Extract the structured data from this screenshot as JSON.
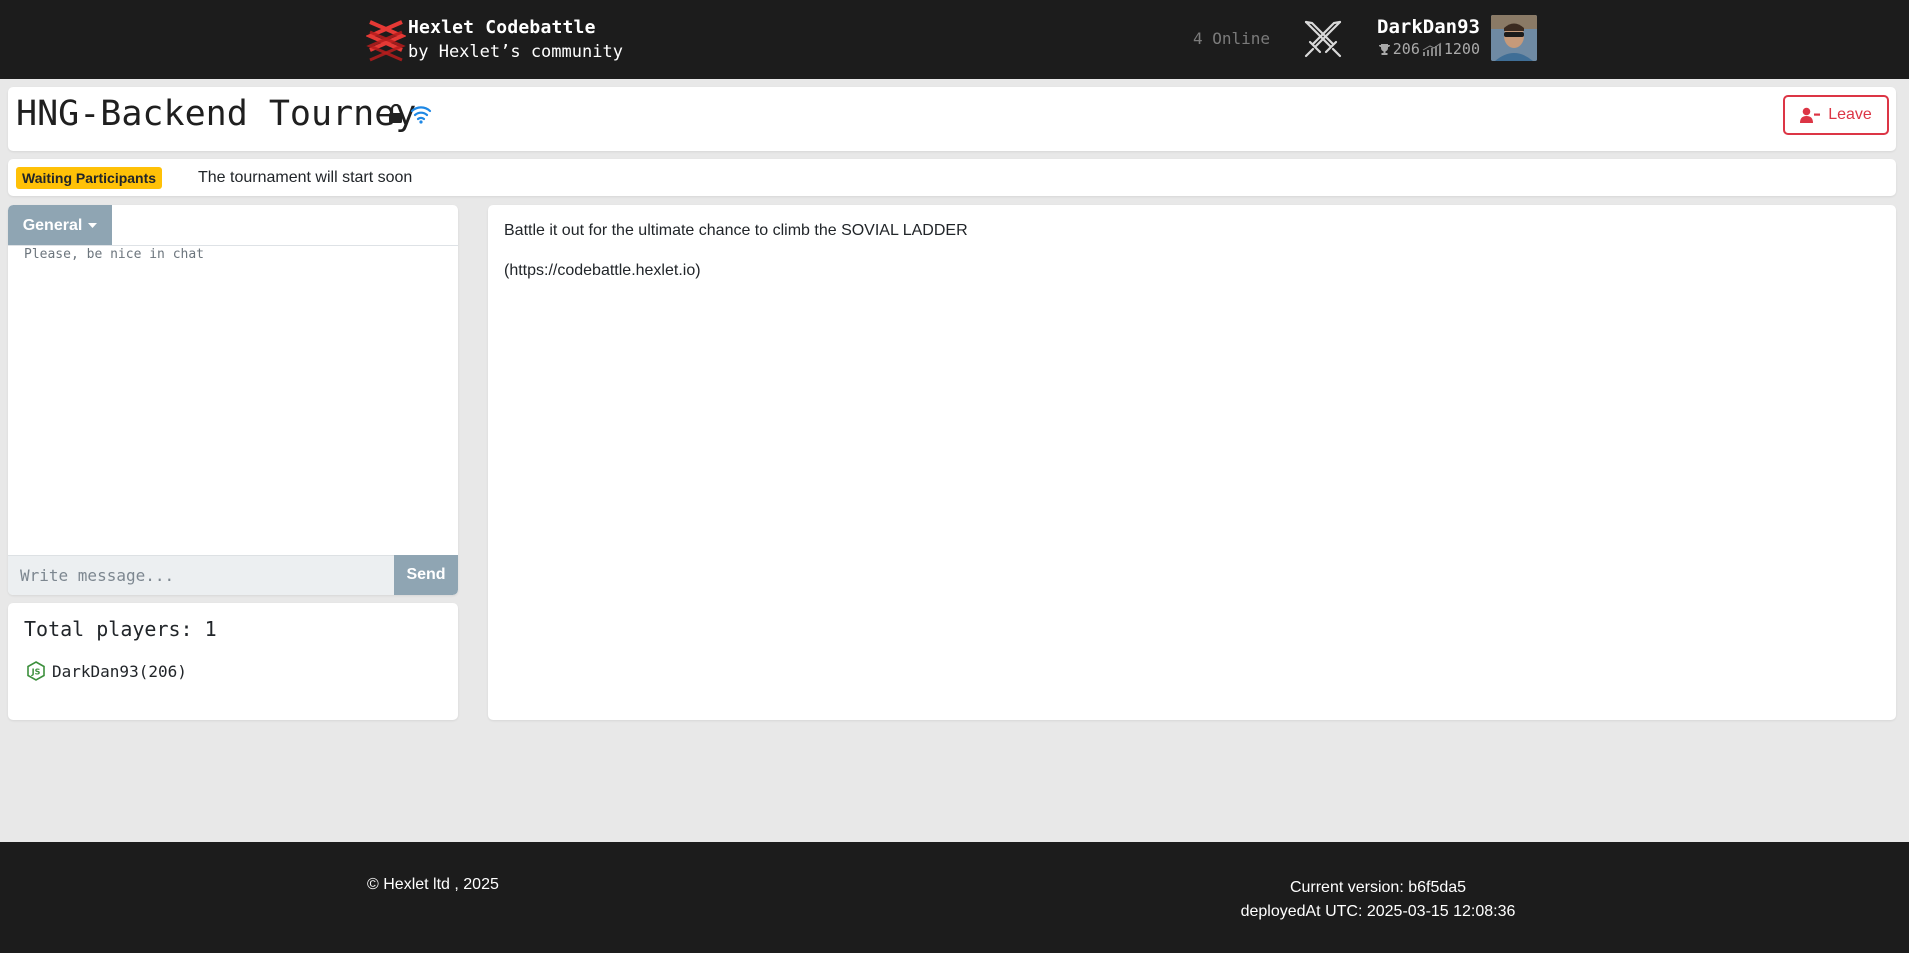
{
  "navbar": {
    "brand_title": "Hexlet Codebattle",
    "brand_sub": "by Hexlet’s community",
    "online": "4 Online",
    "user": {
      "name": "DarkDan93",
      "rating": "206",
      "points": "1200"
    }
  },
  "tournament": {
    "title": "HNG-Backend Tourney",
    "leave_label": "Leave",
    "status_badge": "Waiting Participants",
    "status_text": "The tournament will start soon"
  },
  "chat": {
    "tab_label": "General",
    "hint": "Please, be nice in chat",
    "input_placeholder": "Write message...",
    "send_label": "Send"
  },
  "players": {
    "title": "Total players: 1",
    "items": [
      {
        "name": "DarkDan93(206)",
        "lang_icon": "nodejs-icon"
      }
    ]
  },
  "description": {
    "lines": [
      "Battle it out for the ultimate chance to climb the SOVIAL LADDER",
      "(https://codebattle.hexlet.io)"
    ]
  },
  "footer": {
    "copyright": "© Hexlet ltd , 2025",
    "version": "Current version: b6f5da5",
    "deployed": "deployedAt UTC: 2025-03-15 12:08:36"
  },
  "colors": {
    "navbar_bg": "#1c1c1c",
    "page_bg": "#e8e8e8",
    "danger": "#dc3545",
    "warning": "#ffc107",
    "chat_accent": "#8fa5b3",
    "wifi_blue": "#1e88e5"
  }
}
